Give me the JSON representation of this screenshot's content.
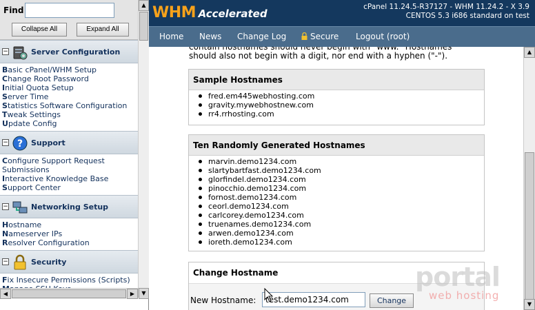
{
  "left": {
    "find_label": "Find",
    "find_value": "",
    "collapse_label": "Collapse All",
    "expand_label": "Expand All",
    "sections": [
      {
        "title": "Server Configuration",
        "icon": "server-icon",
        "links": [
          {
            "first": "B",
            "rest": "asic cPanel/WHM Setup"
          },
          {
            "first": "C",
            "rest": "hange Root Password"
          },
          {
            "first": "I",
            "rest": "nitial Quota Setup"
          },
          {
            "first": "S",
            "rest": "erver Time"
          },
          {
            "first": "S",
            "rest": "tatistics Software Configuration"
          },
          {
            "first": "T",
            "rest": "weak Settings"
          },
          {
            "first": "U",
            "rest": "pdate Config"
          }
        ]
      },
      {
        "title": "Support",
        "icon": "help-icon",
        "links": [
          {
            "first": "C",
            "rest": "onfigure Support Request Submissions"
          },
          {
            "first": "I",
            "rest": "nteractive Knowledge Base"
          },
          {
            "first": "S",
            "rest": "upport Center"
          }
        ]
      },
      {
        "title": "Networking Setup",
        "icon": "network-icon",
        "links": [
          {
            "first": "H",
            "rest": "ostname"
          },
          {
            "first": "N",
            "rest": "ameserver IPs"
          },
          {
            "first": "R",
            "rest": "esolver Configuration"
          }
        ]
      },
      {
        "title": "Security",
        "icon": "lock-icon",
        "links": [
          {
            "first": "F",
            "rest": "ix Insecure Permissions (Scripts)"
          },
          {
            "first": "M",
            "rest": "anage SSH Keys"
          }
        ]
      }
    ]
  },
  "header": {
    "logo_main": "WHM",
    "logo_sub": "Accelerated",
    "version_line1": "cPanel 11.24.5-R37127 - WHM 11.24.2 - X 3.9",
    "version_line2": "CENTOS 5.3 i686 standard on test"
  },
  "nav": {
    "home": "Home",
    "news": "News",
    "changelog": "Change Log",
    "secure": "Secure",
    "logout": "Logout (root)"
  },
  "main": {
    "cut_text": "contain hostnames should never begin with \"www.\" Hostnames should also not begin with a digit, nor end with a hyphen (\"-\").",
    "sample": {
      "title": "Sample Hostnames",
      "items": [
        "fred.em445webhosting.com",
        "gravity.mywebhostnew.com",
        "rr4.rrhosting.com"
      ]
    },
    "random": {
      "title": "Ten Randomly Generated Hostnames",
      "items": [
        "marvin.demo1234.com",
        "slartybartfast.demo1234.com",
        "glorfindel.demo1234.com",
        "pinocchio.demo1234.com",
        "fornost.demo1234.com",
        "ceorl.demo1234.com",
        "carlcorey.demo1234.com",
        "truenames.demo1234.com",
        "arwen.demo1234.com",
        "ioreth.demo1234.com"
      ]
    },
    "change": {
      "title": "Change Hostname",
      "label": "New Hostname:",
      "value": "test.demo1234.com",
      "button": "Change"
    }
  },
  "watermark": {
    "main": "portal",
    "sub": "web hosting"
  },
  "colors": {
    "header_bg": "#14385e",
    "nav_bg": "#4a6c8c",
    "logo_accent": "#f7a21b",
    "link": "#13315c"
  }
}
